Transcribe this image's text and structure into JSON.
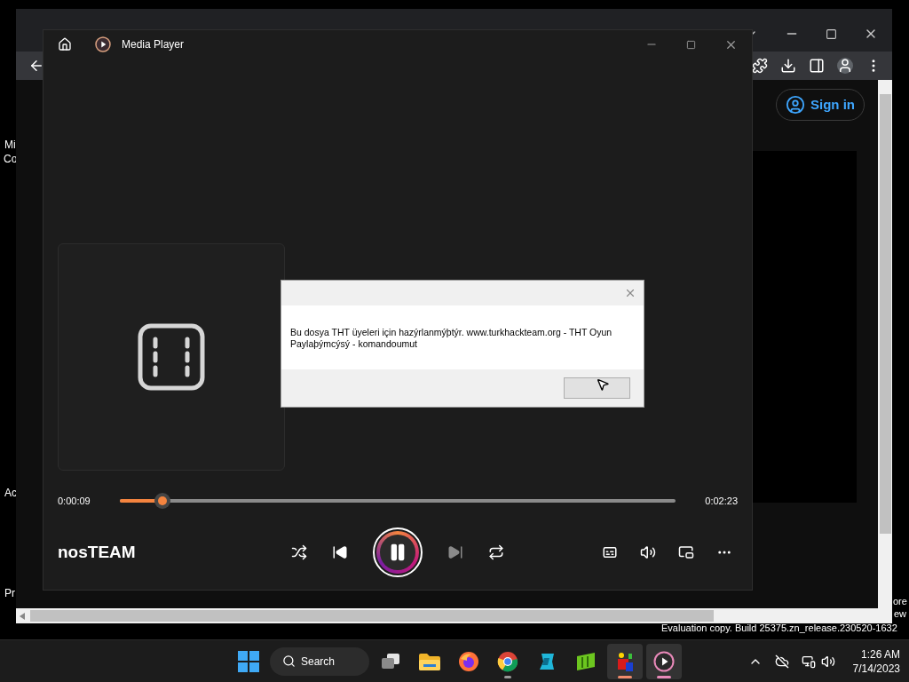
{
  "desktop": {
    "left_labels": [
      "Mi",
      "Co",
      "Ac",
      "Pr"
    ],
    "right_labels": [
      "ore",
      "ew"
    ],
    "build_notice": "Evaluation copy. Build 25375.zn_release.230520-1632"
  },
  "browser": {
    "sign_in": "Sign in"
  },
  "media_player": {
    "title": "Media Player",
    "track": "nosTEAM",
    "elapsed": "0:00:09",
    "duration": "0:02:23",
    "progress": {
      "level": 0.076
    },
    "playing": true
  },
  "dialog": {
    "message": "Bu dosya THT üyeleri için hazýrlanmýþtýr. www.turkhackteam.org - THT Oyun Paylaþýmcýsý - komandoumut"
  },
  "taskbar": {
    "search": "Search",
    "apps": [
      {
        "kind": "task-view",
        "running": false,
        "active": false
      },
      {
        "kind": "folder",
        "running": false,
        "active": false
      },
      {
        "kind": "firefox",
        "running": false,
        "active": false
      },
      {
        "kind": "chrome",
        "running": true,
        "active": false,
        "color": "#9a9a9a"
      },
      {
        "kind": "cyan-app",
        "running": false,
        "active": false
      },
      {
        "kind": "green-app",
        "running": false,
        "active": false
      },
      {
        "kind": "tool-app",
        "running": true,
        "active": true,
        "color": "#f08a6b"
      },
      {
        "kind": "media-player",
        "running": true,
        "active": true,
        "color": "#e889b9"
      }
    ],
    "time": "1:26 AM",
    "date": "7/14/2023"
  }
}
